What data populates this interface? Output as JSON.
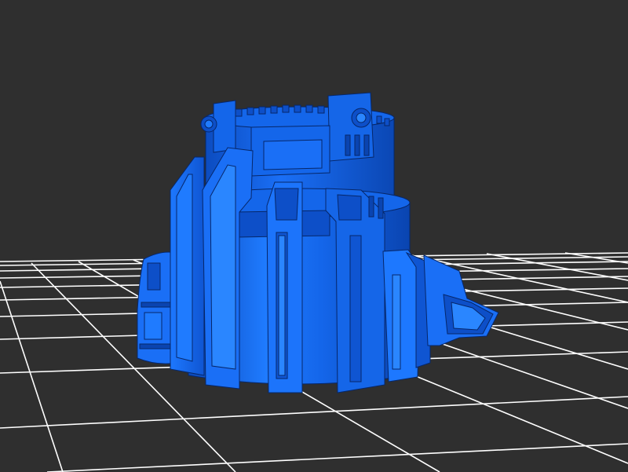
{
  "scene": {
    "background_color": "#2f2f2f",
    "grid_color": "#ffffff",
    "model_color": "#1566e8",
    "model_highlight": "#2a86ff",
    "model_shadow": "#0a3fa3",
    "model_edge": "#06276a"
  }
}
